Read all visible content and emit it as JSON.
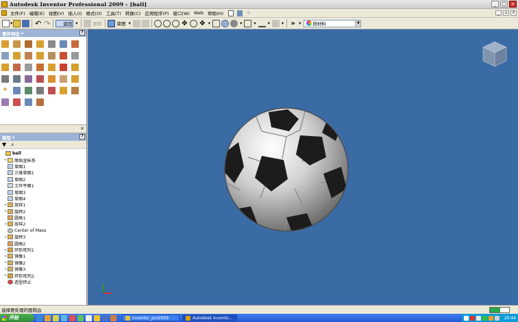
{
  "window": {
    "title": "Autodesk Inventor Professional 2009 - [ball]"
  },
  "menu": {
    "items": [
      "文件(F)",
      "编辑(E)",
      "视图(V)",
      "插入(I)",
      "格式(O)",
      "工具(T)",
      "转换(C)",
      "应用程序(P)",
      "窗口(W)",
      "Web",
      "帮助(H)"
    ]
  },
  "toolbar": {
    "return_label": "返回",
    "sketch_label": "草图",
    "update_label": "更新",
    "material": "按材料"
  },
  "panels": {
    "features_title": "零件特征",
    "browser_title": "模型"
  },
  "tree": [
    {
      "label": "ball",
      "level": 0,
      "icon": "part",
      "expander": "",
      "root": true
    },
    {
      "label": "原始坐标系",
      "level": 1,
      "icon": "folder",
      "expander": "+"
    },
    {
      "label": "草图1",
      "level": 1,
      "icon": "sketch",
      "expander": ""
    },
    {
      "label": "三维草图1",
      "level": 1,
      "icon": "sketch",
      "expander": ""
    },
    {
      "label": "草图2",
      "level": 1,
      "icon": "sketch",
      "expander": ""
    },
    {
      "label": "工作平面1",
      "level": 1,
      "icon": "plane",
      "expander": ""
    },
    {
      "label": "草图3",
      "level": 1,
      "icon": "sketch",
      "expander": ""
    },
    {
      "label": "草图4",
      "level": 1,
      "icon": "sketch",
      "expander": ""
    },
    {
      "label": "放样1",
      "level": 1,
      "icon": "feature",
      "expander": "+"
    },
    {
      "label": "旋转2",
      "level": 1,
      "icon": "feature",
      "expander": "+"
    },
    {
      "label": "圆角1",
      "level": 1,
      "icon": "fillet",
      "expander": ""
    },
    {
      "label": "放样2",
      "level": 1,
      "icon": "feature",
      "expander": "+"
    },
    {
      "label": "Center of Mass",
      "level": 1,
      "icon": "com",
      "expander": ""
    },
    {
      "label": "旋转3",
      "level": 1,
      "icon": "feature",
      "expander": "+"
    },
    {
      "label": "圆角2",
      "level": 1,
      "icon": "fillet",
      "expander": ""
    },
    {
      "label": "环形阵列1",
      "level": 1,
      "icon": "pattern",
      "expander": "+"
    },
    {
      "label": "镜像1",
      "level": 1,
      "icon": "mirror",
      "expander": "+"
    },
    {
      "label": "镜像2",
      "level": 1,
      "icon": "mirror",
      "expander": "+"
    },
    {
      "label": "镜像3",
      "level": 1,
      "icon": "mirror",
      "expander": "+"
    },
    {
      "label": "环形阵列2",
      "level": 1,
      "icon": "pattern",
      "expander": "+"
    },
    {
      "label": "造型终止",
      "level": 1,
      "icon": "eop",
      "expander": ""
    }
  ],
  "status": {
    "text": "选择要处理的面和边"
  },
  "memory_usage": 0.55,
  "taskbar": {
    "start_label": "开始",
    "tasks": [
      {
        "label": "inventor_pro2009",
        "active": false
      },
      {
        "label": "Autodesk Invento...",
        "active": true
      }
    ],
    "clock": "20:44"
  },
  "colors": {
    "viewport_bg": "#3a6ba5",
    "panel_header": "#9db4d6",
    "taskbar": "#245edb"
  }
}
